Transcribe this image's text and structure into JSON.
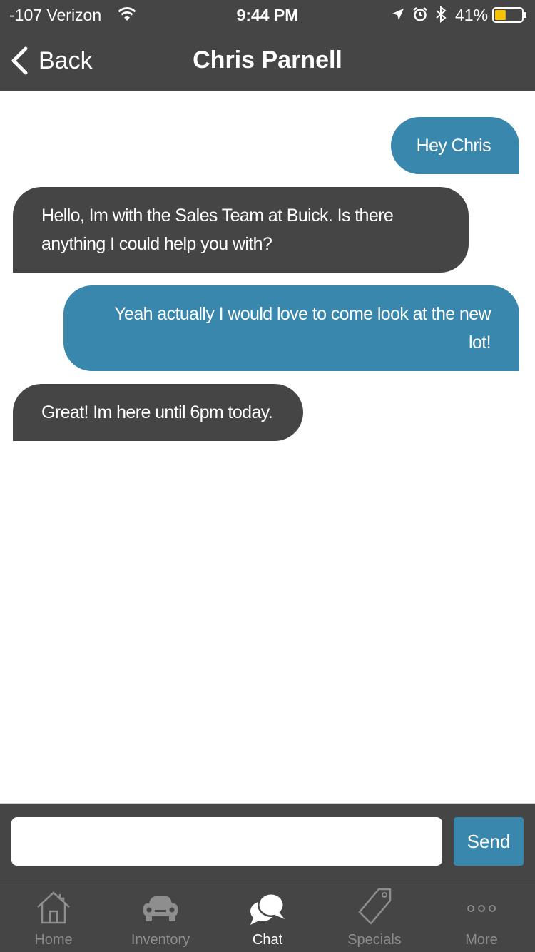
{
  "status_bar": {
    "carrier": "-107 Verizon",
    "time": "9:44 PM",
    "battery_percent": "41%",
    "battery_level": 0.41,
    "icons": [
      "wifi-icon",
      "location-arrow-icon",
      "alarm-icon",
      "bluetooth-icon",
      "battery-icon"
    ]
  },
  "nav": {
    "back_label": "Back",
    "title": "Chris Parnell"
  },
  "messages": [
    {
      "direction": "outgoing",
      "text": "Hey Chris"
    },
    {
      "direction": "incoming",
      "text": "Hello, Im with the Sales Team at Buick. Is there anything I could help you with?"
    },
    {
      "direction": "outgoing",
      "text": "Yeah actually I would love to come look at the new lot!"
    },
    {
      "direction": "incoming",
      "text": "Great! Im here until 6pm today."
    }
  ],
  "composer": {
    "input_value": "",
    "placeholder": "",
    "send_label": "Send"
  },
  "tabs": [
    {
      "label": "Home",
      "icon": "home-icon",
      "active": false
    },
    {
      "label": "Inventory",
      "icon": "car-icon",
      "active": false
    },
    {
      "label": "Chat",
      "icon": "chat-bubbles-icon",
      "active": true
    },
    {
      "label": "Specials",
      "icon": "tag-icon",
      "active": false
    },
    {
      "label": "More",
      "icon": "more-dots-icon",
      "active": false
    }
  ],
  "colors": {
    "bar_background": "#454545",
    "outgoing_bubble": "#3a87ae",
    "incoming_bubble": "#454545",
    "send_button": "#3a87ae",
    "battery_fill": "#f5c400"
  }
}
